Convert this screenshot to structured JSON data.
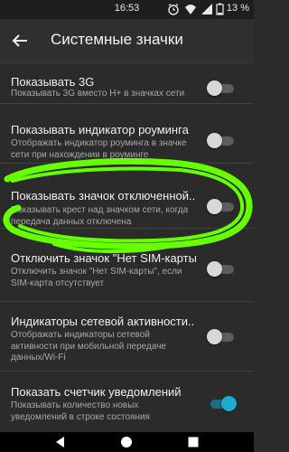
{
  "status_bar": {
    "time": "16:53",
    "battery": "13 %",
    "icons": [
      "alarm-icon",
      "wifi-icon",
      "signal-icon",
      "battery-icon"
    ]
  },
  "app_bar": {
    "title": "Системные значки",
    "back_icon": "arrow-back-icon"
  },
  "settings": [
    {
      "title": "Показывать 3G",
      "subtitle": "Показывать 3G вместо H+ в значках сети",
      "enabled": false
    },
    {
      "title": "Показывать индикатор роуминга",
      "subtitle": "Отображать индикатор роуминга в значке сети при нахождении в роуминге",
      "enabled": false
    },
    {
      "title": "Показывать значок отключенной..",
      "subtitle": "Показывать крест над значком сети, когда передача данных отключена",
      "enabled": false
    },
    {
      "title": "Отключить значок \"Нет SIM-карты\"",
      "subtitle": "Отключить значок \"Нет SIM-карты\", если SIM-карта отсутствует",
      "enabled": false
    },
    {
      "title": "Индикаторы сетевой активности..",
      "subtitle": "Отображать индикаторы сетевой активности при мобильной передаче данных/Wi-Fi",
      "enabled": false
    },
    {
      "title": "Показать счетчик уведомлений",
      "subtitle": "Показывать количество новых уведомлений в строке состояния",
      "enabled": true
    }
  ],
  "colors": {
    "background": "#2b2b2b",
    "accent": "#1fa9cc",
    "annotation": "#66ff00"
  },
  "nav_bar": {
    "icons": [
      "back-triangle-icon",
      "home-circle-icon",
      "recents-square-icon"
    ]
  }
}
